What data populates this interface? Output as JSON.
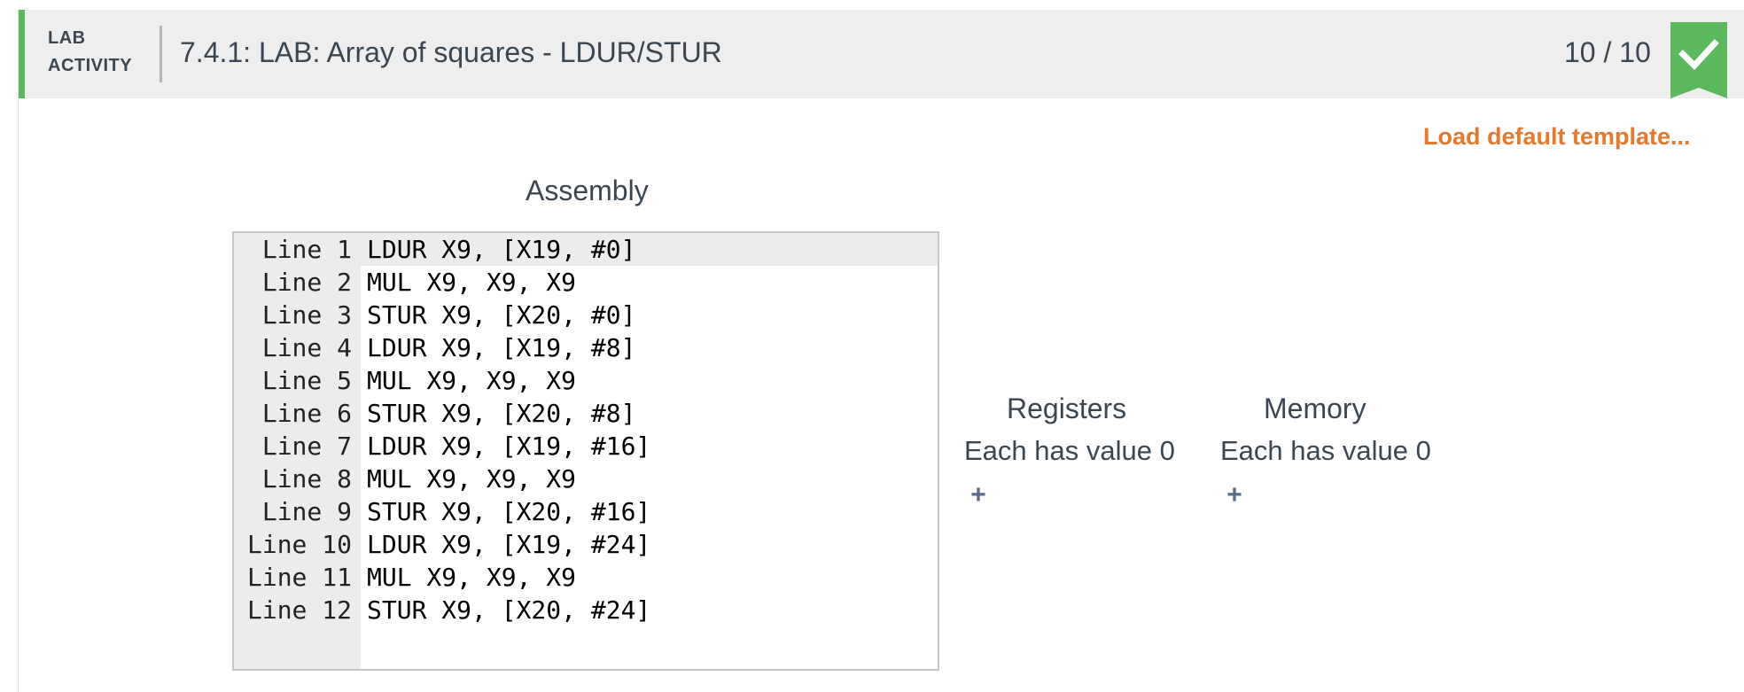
{
  "header": {
    "lab_label_line1": "LAB",
    "lab_label_line2": "ACTIVITY",
    "title": "7.4.1: LAB: Array of squares - LDUR/STUR",
    "score": "10 / 10",
    "status_icon": "check-icon",
    "accent_color": "#5cb85c"
  },
  "toolbar": {
    "load_default_template": "Load default template..."
  },
  "assembly": {
    "title": "Assembly",
    "lines": [
      {
        "num": "Line 1",
        "code": "LDUR X9, [X19, #0]"
      },
      {
        "num": "Line 2",
        "code": "MUL X9, X9, X9"
      },
      {
        "num": "Line 3",
        "code": "STUR X9, [X20, #0]"
      },
      {
        "num": "Line 4",
        "code": "LDUR X9, [X19, #8]"
      },
      {
        "num": "Line 5",
        "code": "MUL X9, X9, X9"
      },
      {
        "num": "Line 6",
        "code": "STUR X9, [X20, #8]"
      },
      {
        "num": "Line 7",
        "code": "LDUR X9, [X19, #16]"
      },
      {
        "num": "Line 8",
        "code": "MUL X9, X9, X9"
      },
      {
        "num": "Line 9",
        "code": "STUR X9, [X20, #16]"
      },
      {
        "num": "Line 10",
        "code": "LDUR X9, [X19, #24]"
      },
      {
        "num": "Line 11",
        "code": "MUL X9, X9, X9"
      },
      {
        "num": "Line 12",
        "code": "STUR X9, [X20, #24]"
      }
    ]
  },
  "registers": {
    "title": "Registers",
    "default_text": "Each has value 0",
    "add_label": "+"
  },
  "memory": {
    "title": "Memory",
    "default_text": "Each has value 0",
    "add_label": "+"
  }
}
